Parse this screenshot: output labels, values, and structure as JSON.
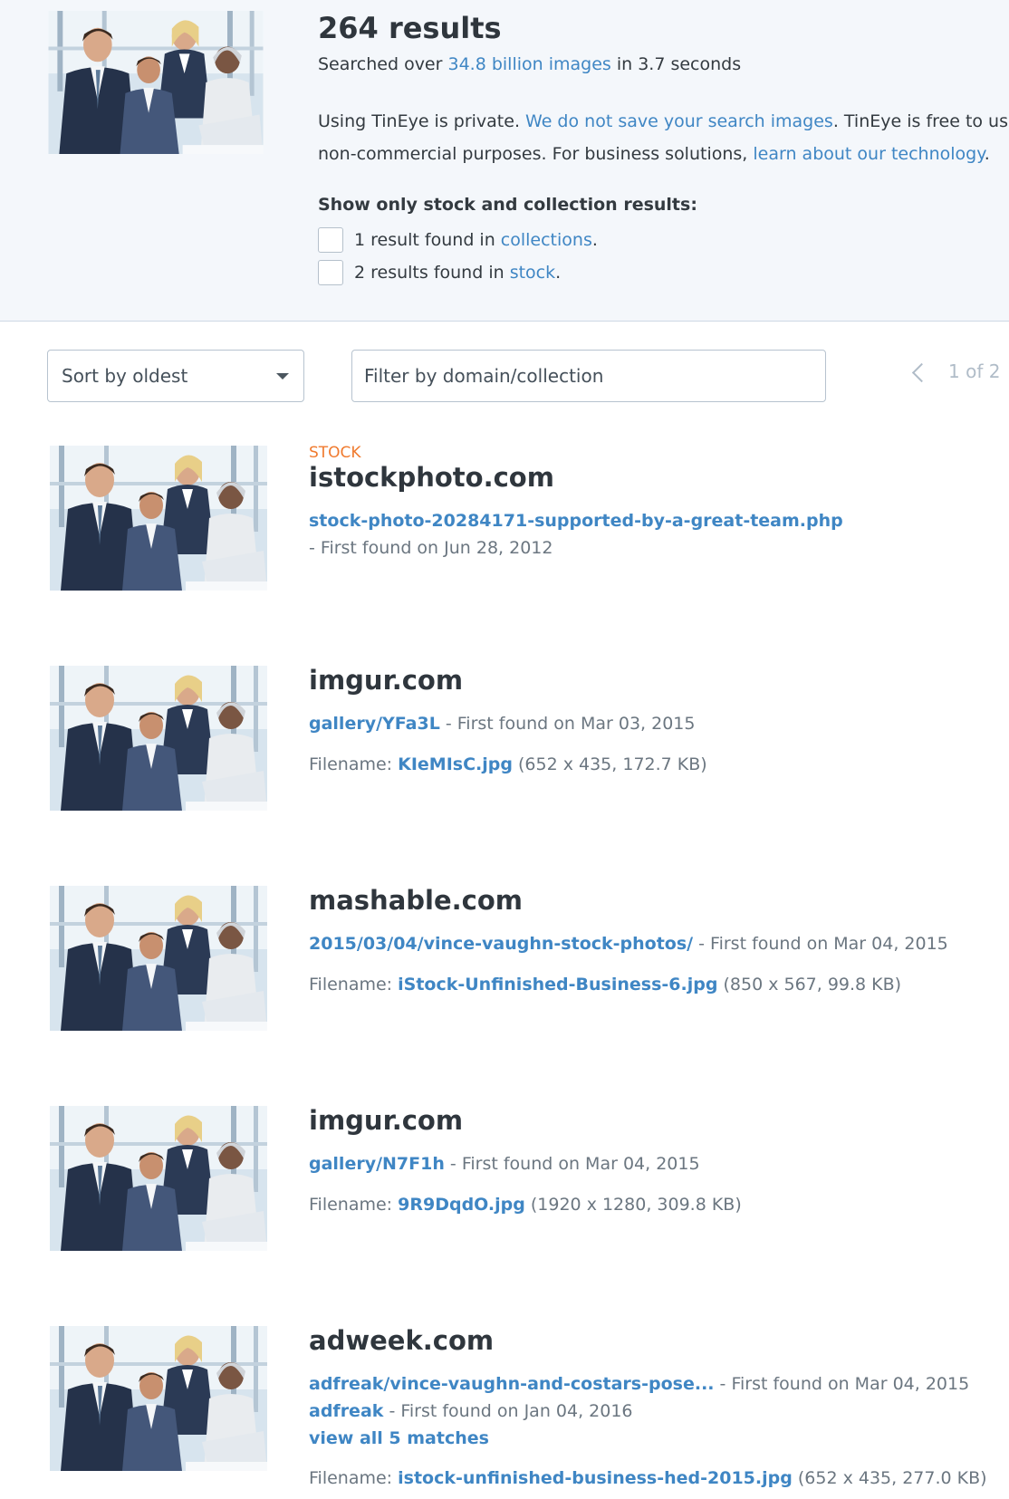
{
  "summary": {
    "count": "264 results",
    "searched_prefix": "Searched over ",
    "searched_link": "34.8 billion images",
    "searched_suffix": " in 3.7 seconds",
    "privacy_1a": "Using TinEye is private. ",
    "privacy_1_link": "We do not save your search images",
    "privacy_1b": ". TinEye is free to use",
    "privacy_2a": "non-commercial purposes. For business solutions, ",
    "privacy_2_link": "learn about our technology",
    "privacy_2b": ".",
    "stock_title": "Show only stock and collection results:",
    "collections_prefix": "1 result found in ",
    "collections_link": "collections",
    "stock_prefix": "2 results found in ",
    "stock_link": "stock",
    "period": "."
  },
  "controls": {
    "sort_label": "Sort by oldest",
    "filter_placeholder": "Filter by domain/collection",
    "page_info": "1 of 2"
  },
  "results": [
    {
      "tag": "STOCK",
      "domain": "istockphoto.com",
      "path": "stock-photo-20284171-supported-by-a-great-team.php",
      "first_found": "- First found on Jun 28, 2012"
    },
    {
      "domain": "imgur.com",
      "path": "gallery/YFa3L",
      "first_found": " - First found on Mar 03, 2015",
      "filename_label": "Filename: ",
      "filename": "KIeMIsC.jpg",
      "meta": " (652 x 435, 172.7 KB)"
    },
    {
      "domain": "mashable.com",
      "path": "2015/03/04/vince-vaughn-stock-photos/",
      "first_found": " - First found on Mar 04, 2015",
      "filename_label": "Filename: ",
      "filename": "iStock-Unfinished-Business-6.jpg",
      "meta": " (850 x 567, 99.8 KB)"
    },
    {
      "domain": "imgur.com",
      "path": "gallery/N7F1h",
      "first_found": " - First found on Mar 04, 2015",
      "filename_label": "Filename: ",
      "filename": "9R9DqdO.jpg",
      "meta": " (1920 x 1280, 309.8 KB)"
    },
    {
      "domain": "adweek.com",
      "path": "adfreak/vince-vaughn-and-costars-pose...",
      "first_found": " - First found on Mar 04, 2015",
      "path2": "adfreak",
      "first_found2": " - First found on Jan 04, 2016",
      "view_all": "view all 5 matches",
      "filename_label": "Filename: ",
      "filename": "istock-unfinished-business-hed-2015.jpg",
      "meta": " (652 x 435, 277.0 KB)"
    }
  ]
}
